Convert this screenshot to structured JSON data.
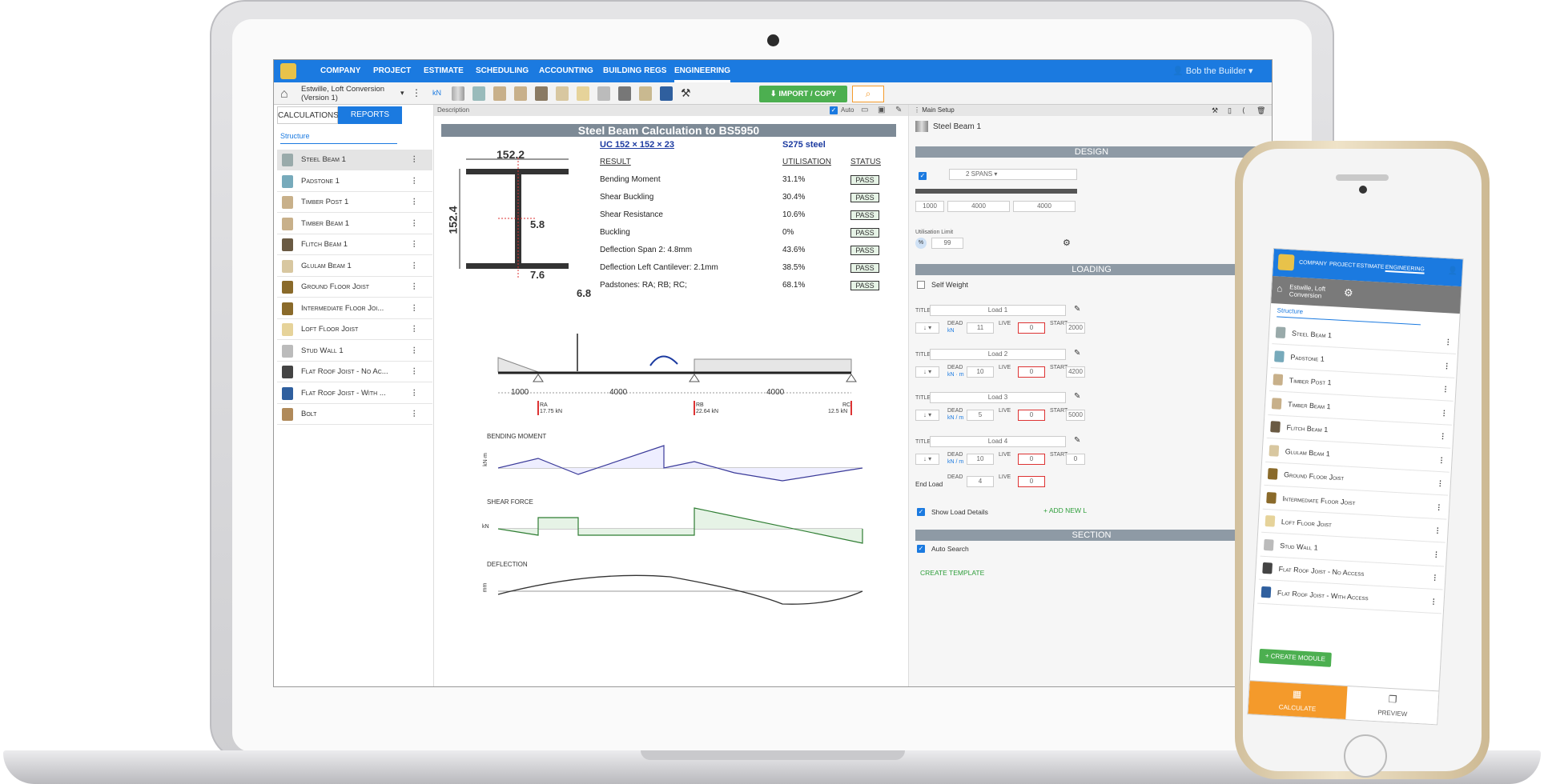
{
  "nav": {
    "items": [
      "COMPANY",
      "PROJECT",
      "ESTIMATE",
      "SCHEDULING",
      "ACCOUNTING",
      "BUILDING REGS",
      "ENGINEERING"
    ],
    "user": "Bob the Builder"
  },
  "toolbar": {
    "project_name": "Estwille, Loft Conversion",
    "project_version": "(Version 1)",
    "unit": "kN",
    "import_label": "IMPORT / COPY"
  },
  "left": {
    "tab_calculations": "CALCULATIONS",
    "tab_reports": "REPORTS",
    "structure_label": "Structure",
    "items": [
      "Steel Beam 1",
      "Padstone 1",
      "Timber Post 1",
      "Timber Beam 1",
      "Flitch Beam 1",
      "Glulam Beam 1",
      "Ground Floor Joist",
      "Intermediate Floor Joi...",
      "Loft Floor Joist",
      "Stud Wall 1",
      "Flat Roof Joist - No Ac...",
      "Flat Roof Joist - With ...",
      "Bolt"
    ]
  },
  "center": {
    "description_label": "Description",
    "auto_label": "Auto",
    "title": "Steel Beam Calculation to BS5950",
    "section_name": "UC 152 × 152 × 23",
    "grade": "S275 steel",
    "dims": {
      "width": "152.2",
      "height": "152.4",
      "web": "5.8",
      "flange": "7.6",
      "root": "6.8"
    },
    "headers": {
      "result": "RESULT",
      "utilisation": "UTILISATION",
      "status": "STATUS"
    },
    "results": [
      {
        "name": "Bending Moment",
        "util": "31.1%",
        "status": "PASS"
      },
      {
        "name": "Shear Buckling",
        "util": "30.4%",
        "status": "PASS"
      },
      {
        "name": "Shear Resistance",
        "util": "10.6%",
        "status": "PASS"
      },
      {
        "name": "Buckling",
        "util": "0%",
        "status": "PASS"
      },
      {
        "name": "Deflection Span 2:   4.8mm",
        "util": "43.6%",
        "status": "PASS"
      },
      {
        "name": "Deflection Left Cantilever:   2.1mm",
        "util": "38.5%",
        "status": "PASS"
      },
      {
        "name": "Padstones:   RA; RB; RC;",
        "util": "68.1%",
        "status": "PASS"
      }
    ],
    "spans": [
      "1000",
      "4000",
      "4000"
    ],
    "reactions": [
      {
        "name": "RA",
        "value": "17.75 kN"
      },
      {
        "name": "RB",
        "value": "22.64 kN"
      },
      {
        "name": "RC",
        "value": "12.5 kN"
      }
    ],
    "diagram_labels": {
      "bending": "BENDING MOMENT",
      "shear": "SHEAR FORCE",
      "deflection": "DEFLECTION"
    },
    "units": {
      "bending": "kN·m",
      "shear": "kN",
      "deflection": "mm"
    }
  },
  "right": {
    "main_setup": "Main Setup",
    "module_name": "Steel Beam 1",
    "design_header": "DESIGN",
    "spans_select": "2 SPANS",
    "span_values": [
      "1000",
      "4000",
      "4000"
    ],
    "utilisation_limit_label": "Utilisation Limit",
    "utilisation_limit": "99",
    "loading_header": "LOADING",
    "self_weight": "Self Weight",
    "title_label": "TITLE",
    "dead_label": "DEAD",
    "live_label": "LIVE",
    "start_label": "START",
    "loads": [
      {
        "title": "Load 1",
        "dead": "11",
        "live": "0",
        "start": "2000",
        "unit": "kN"
      },
      {
        "title": "Load 2",
        "dead": "10",
        "live": "0",
        "start": "4200",
        "unit": "kN · m"
      },
      {
        "title": "Load 3",
        "dead": "5",
        "live": "0",
        "start": "5000",
        "unit": "kN / m"
      },
      {
        "title": "Load 4",
        "dead": "10",
        "live": "0",
        "start": "0",
        "unit": "kN / m"
      }
    ],
    "end_load_label": "End Load",
    "end_dead": "4",
    "end_live": "0",
    "show_load_details": "Show Load Details",
    "add_new_load": "ADD NEW L",
    "section_header": "SECTION",
    "auto_search": "Auto Search",
    "create_template": "CREATE TEMPLATE"
  },
  "phone": {
    "nav_items": [
      "COMPANY",
      "PROJECT",
      "ESTIMATE",
      "ENGINEERING"
    ],
    "project": "Estwille, Loft Conversion",
    "structure_label": "Structure",
    "items": [
      "Steel Beam 1",
      "Padstone 1",
      "Timber Post 1",
      "Timber Beam 1",
      "Flitch Beam 1",
      "Glulam Beam 1",
      "Ground Floor Joist",
      "Intermediate Floor Joist",
      "Loft Floor Joist",
      "Stud Wall 1",
      "Flat Roof Joist - No Access",
      "Flat Roof Joist - With Access"
    ],
    "create_module": "+ CREATE MODULE",
    "calculate": "CALCULATE",
    "preview": "PREVIEW"
  },
  "colors": {
    "primary": "#1b7ae0",
    "accent": "#f49a2b",
    "success": "#4caf50"
  }
}
